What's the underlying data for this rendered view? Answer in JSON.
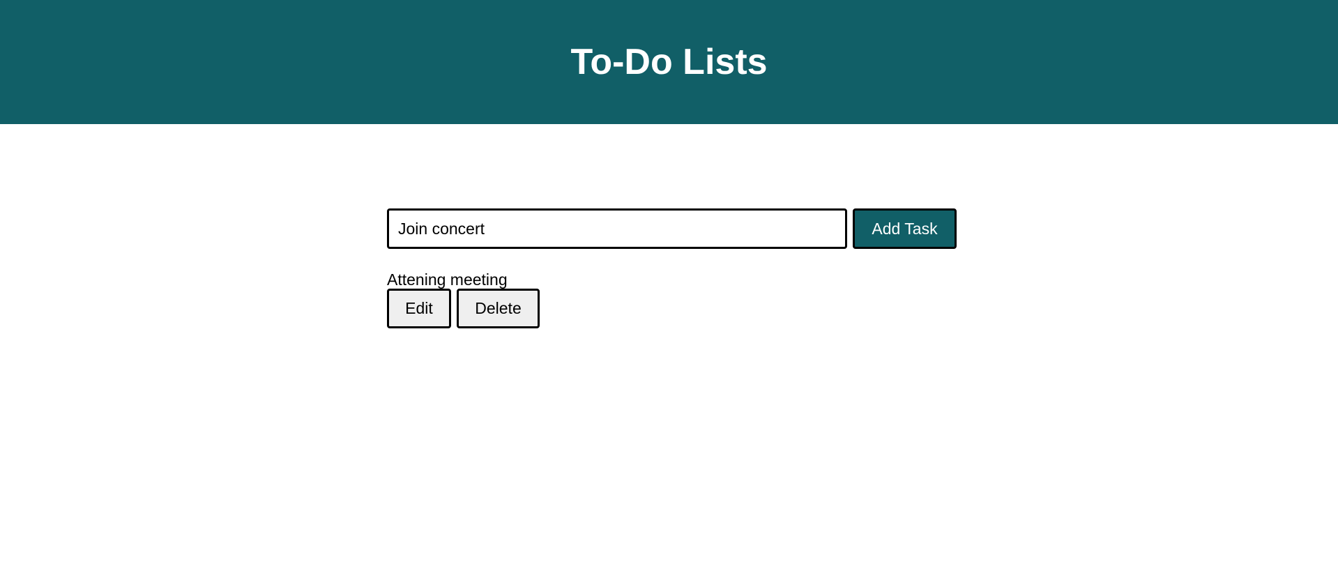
{
  "header": {
    "title": "To-Do Lists"
  },
  "form": {
    "input_value": "Join concert",
    "add_button_label": "Add Task"
  },
  "tasks": [
    {
      "text": "Attening meeting",
      "edit_label": "Edit",
      "delete_label": "Delete"
    }
  ],
  "colors": {
    "header_background": "#115f67",
    "primary_button": "#115f67",
    "secondary_button": "#efefef"
  }
}
